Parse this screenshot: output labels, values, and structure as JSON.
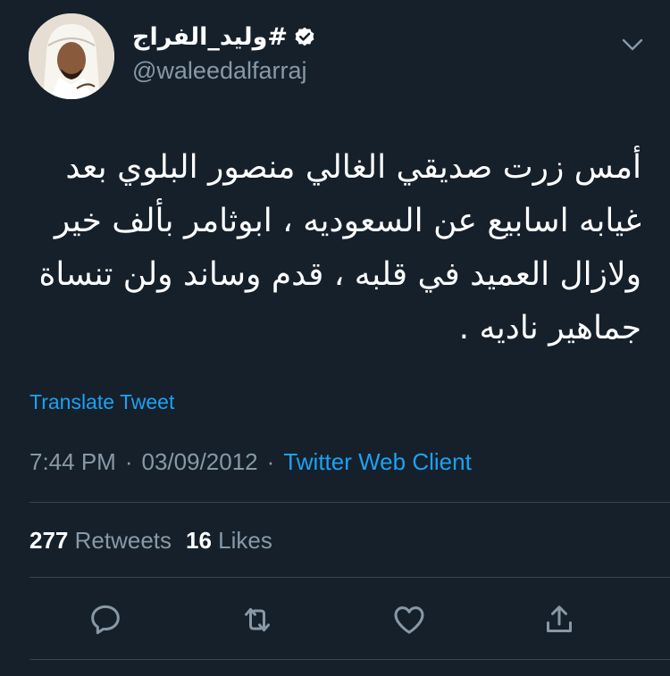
{
  "user": {
    "display_name": "#وليد_الفراج",
    "handle": "@waleedalfarraj",
    "verified": true
  },
  "tweet": {
    "text": "أمس زرت صديقي الغالي منصور البلوي بعد غيابه اسابيع عن السعوديه ، ابوثامر بألف خير ولازال العميد في قلبه ، قدم وساند ولن تنساة جماهير ناديه .",
    "translate_label": "Translate Tweet",
    "time": "7:44 PM",
    "date": "03/09/2012",
    "separator": "·",
    "client": "Twitter Web Client"
  },
  "stats": {
    "retweets_count": "277",
    "retweets_label": "Retweets",
    "likes_count": "16",
    "likes_label": "Likes"
  },
  "icons": {
    "menu": "chevron-down-icon",
    "verified": "verified-badge-icon",
    "reply": "reply-icon",
    "retweet": "retweet-icon",
    "like": "heart-icon",
    "share": "share-icon"
  },
  "colors": {
    "background": "#15202b",
    "primary_text": "#ffffff",
    "secondary_text": "#8899a6",
    "accent": "#1da1f2",
    "divider": "#38444d"
  }
}
